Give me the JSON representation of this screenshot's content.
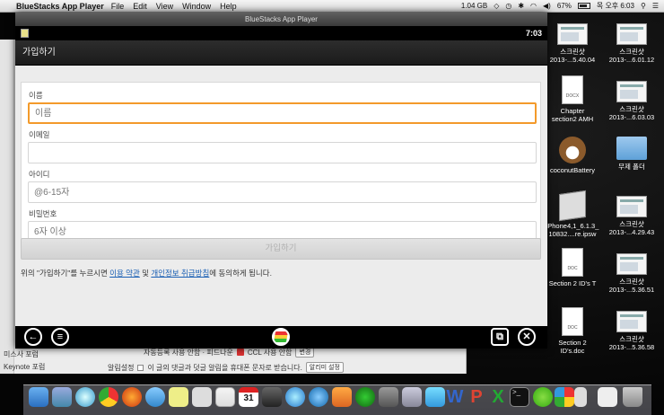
{
  "menubar": {
    "app_name": "BlueStacks App Player",
    "menus": [
      "File",
      "Edit",
      "View",
      "Window",
      "Help"
    ],
    "memory": "1.04 GB",
    "battery": "67%",
    "clock": "목 오후 6:03"
  },
  "window": {
    "title": "BlueStacks App Player"
  },
  "android": {
    "time": "7:03",
    "actionbar_title": "가입하기"
  },
  "form": {
    "name_label": "이름",
    "name_placeholder": "이름",
    "email_label": "이메일",
    "email_placeholder": "",
    "id_label": "아이디",
    "id_placeholder": "@6-15자",
    "password_label": "비밀번호",
    "password_placeholder": "6자 이상",
    "submit_label": "가입하기",
    "terms_prefix": "위의 \"가입하기\"를 누르시면 ",
    "terms_link1": "이용 약관",
    "terms_mid": " 및 ",
    "terms_link2": "개인정보 취급방침",
    "terms_suffix": "에 동의하게 됩니다."
  },
  "background_window": {
    "row1_text": "자동등록 사용 안함  · 피드나운",
    "row1_option": "CCL 사용 안함",
    "row1_button": "변경",
    "row2_label": "알림설정",
    "row2_text": "이 글의 댓글과 덧글 알림을 휴대폰 문자로 받습니다.",
    "row2_button": "알리미 설정",
    "side_item1": "미스사 포럼",
    "side_item2": "Keynote 포럼"
  },
  "desktop_icons": [
    {
      "label1": "스크린샷",
      "label2": "2013-...5.40.04"
    },
    {
      "label1": "스크린샷",
      "label2": "2013-...6.01.12"
    },
    {
      "label1": "Chapter",
      "label2": "section2 AMH"
    },
    {
      "label1": "스크린샷",
      "label2": "2013-...6.03.03"
    },
    {
      "label1": "coconutBattery",
      "label2": ""
    },
    {
      "label1": "무제 폴더",
      "label2": ""
    },
    {
      "label1": "iPhone4,1_6.1.3_",
      "label2": "10832....re.ipsw"
    },
    {
      "label1": "스크린샷",
      "label2": "2013-...4.29.43"
    },
    {
      "label1": "Section 2 ID's T",
      "label2": ""
    },
    {
      "label1": "스크린샷",
      "label2": "2013-...5.36.51"
    },
    {
      "label1": "Section 2",
      "label2": "ID's.doc"
    },
    {
      "label1": "스크린샷",
      "label2": "2013-...5.36.58"
    }
  ],
  "dock": {
    "calendar_day": "31"
  }
}
